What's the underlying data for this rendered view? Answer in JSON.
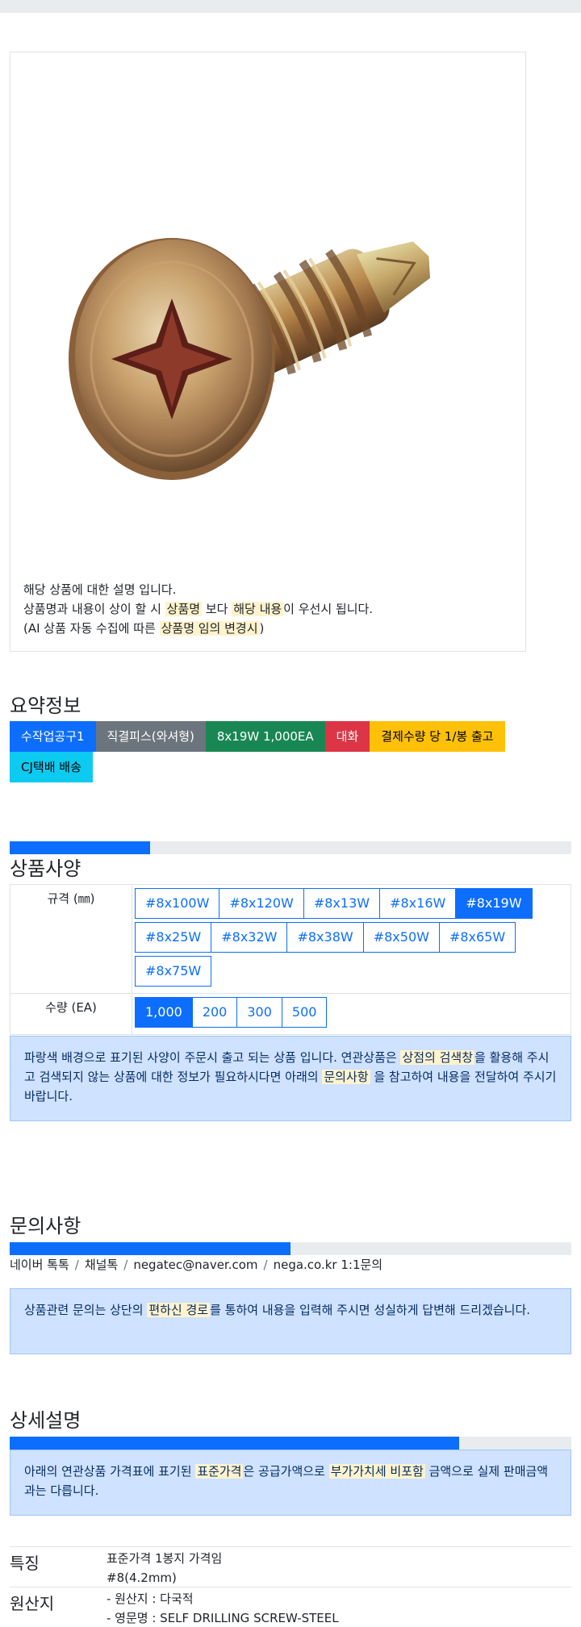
{
  "product_image": {
    "alt": "screw-photo",
    "description": {
      "line1": "해당 상품에 대한 설명 입니다.",
      "line2_pre": "상품명과 내용이 상이 할 시 ",
      "line2_mark1": "상품명",
      "line2_mid": " 보다 ",
      "line2_mark2": "해당 내용",
      "line2_post": "이 우선시 됩니다.",
      "line3_pre": "(AI 상품 자동 수집에 따른 ",
      "line3_mark": "상품명 임의 변경시",
      "line3_post": ")"
    }
  },
  "summary": {
    "title": "요약정보",
    "badges": [
      "수작업공구1",
      "직결피스(와셔형)",
      "8x19W 1,000EA",
      "대화",
      "결제수량 당 1/봉 출고",
      "CJ택배 배송"
    ],
    "badge_colors": [
      "#0d6efd",
      "#6c757d",
      "#198754",
      "#dc3545",
      "#ffc107",
      "#0dcaf0"
    ]
  },
  "spec": {
    "progress": 0.25,
    "title": "상품사양",
    "size_label": "규격 (㎜)",
    "sizes": [
      "#8x100W",
      "#8x120W",
      "#8x13W",
      "#8x16W",
      "#8x19W",
      "#8x25W",
      "#8x32W",
      "#8x38W",
      "#8x50W",
      "#8x65W",
      "#8x75W"
    ],
    "size_selected": "#8x19W",
    "qty_label": "수량 (EA)",
    "quantities": [
      "1,000",
      "200",
      "300",
      "500"
    ],
    "qty_selected": "1,000",
    "notice": {
      "pre": "파랑색 배경으로 표기된 사양이 주문시 출고 되는 상품 입니다. 연관상품은 ",
      "mark1": "상점의 검색창",
      "mid": "을 활용해 주시고 검색되지 않는 상품에 대한 정보가 필요하시다면 아래의 ",
      "mark2": "문의사항",
      "post": " 을 참고하여 내용을 전달하여 주시기 바랍니다."
    }
  },
  "inquiry": {
    "title": "문의사항",
    "progress": 0.5,
    "channels": [
      "네이버 톡톡",
      "채널톡",
      "negatec@naver.com",
      "nega.co.kr 1:1문의"
    ],
    "separator": "/",
    "notice": {
      "pre": "상품관련 문의는 상단의 ",
      "mark": "편하신 경로",
      "post": "를 통하여 내용을 입력해 주시면 성실하게 답변해 드리겠습니다."
    }
  },
  "detail": {
    "title": "상세설명",
    "progress": 0.8,
    "notice": {
      "pre": "아래의 연관상품 가격표에 표기된 ",
      "mark1": "표준가격",
      "mid": "은 공급가액으로 ",
      "mark2": "부가가치세 비포함",
      "post": " 금액으로 실제 판매금액과는 다릅니다."
    },
    "rows": [
      {
        "key": "특징",
        "values": [
          "표준가격 1봉지 가격임",
          "#8(4.2mm)"
        ]
      },
      {
        "key": "원산지",
        "values": [
          "- 원산지 : 다국적",
          "- 영문명 : SELF DRILLING SCREW-STEEL"
        ]
      }
    ]
  }
}
